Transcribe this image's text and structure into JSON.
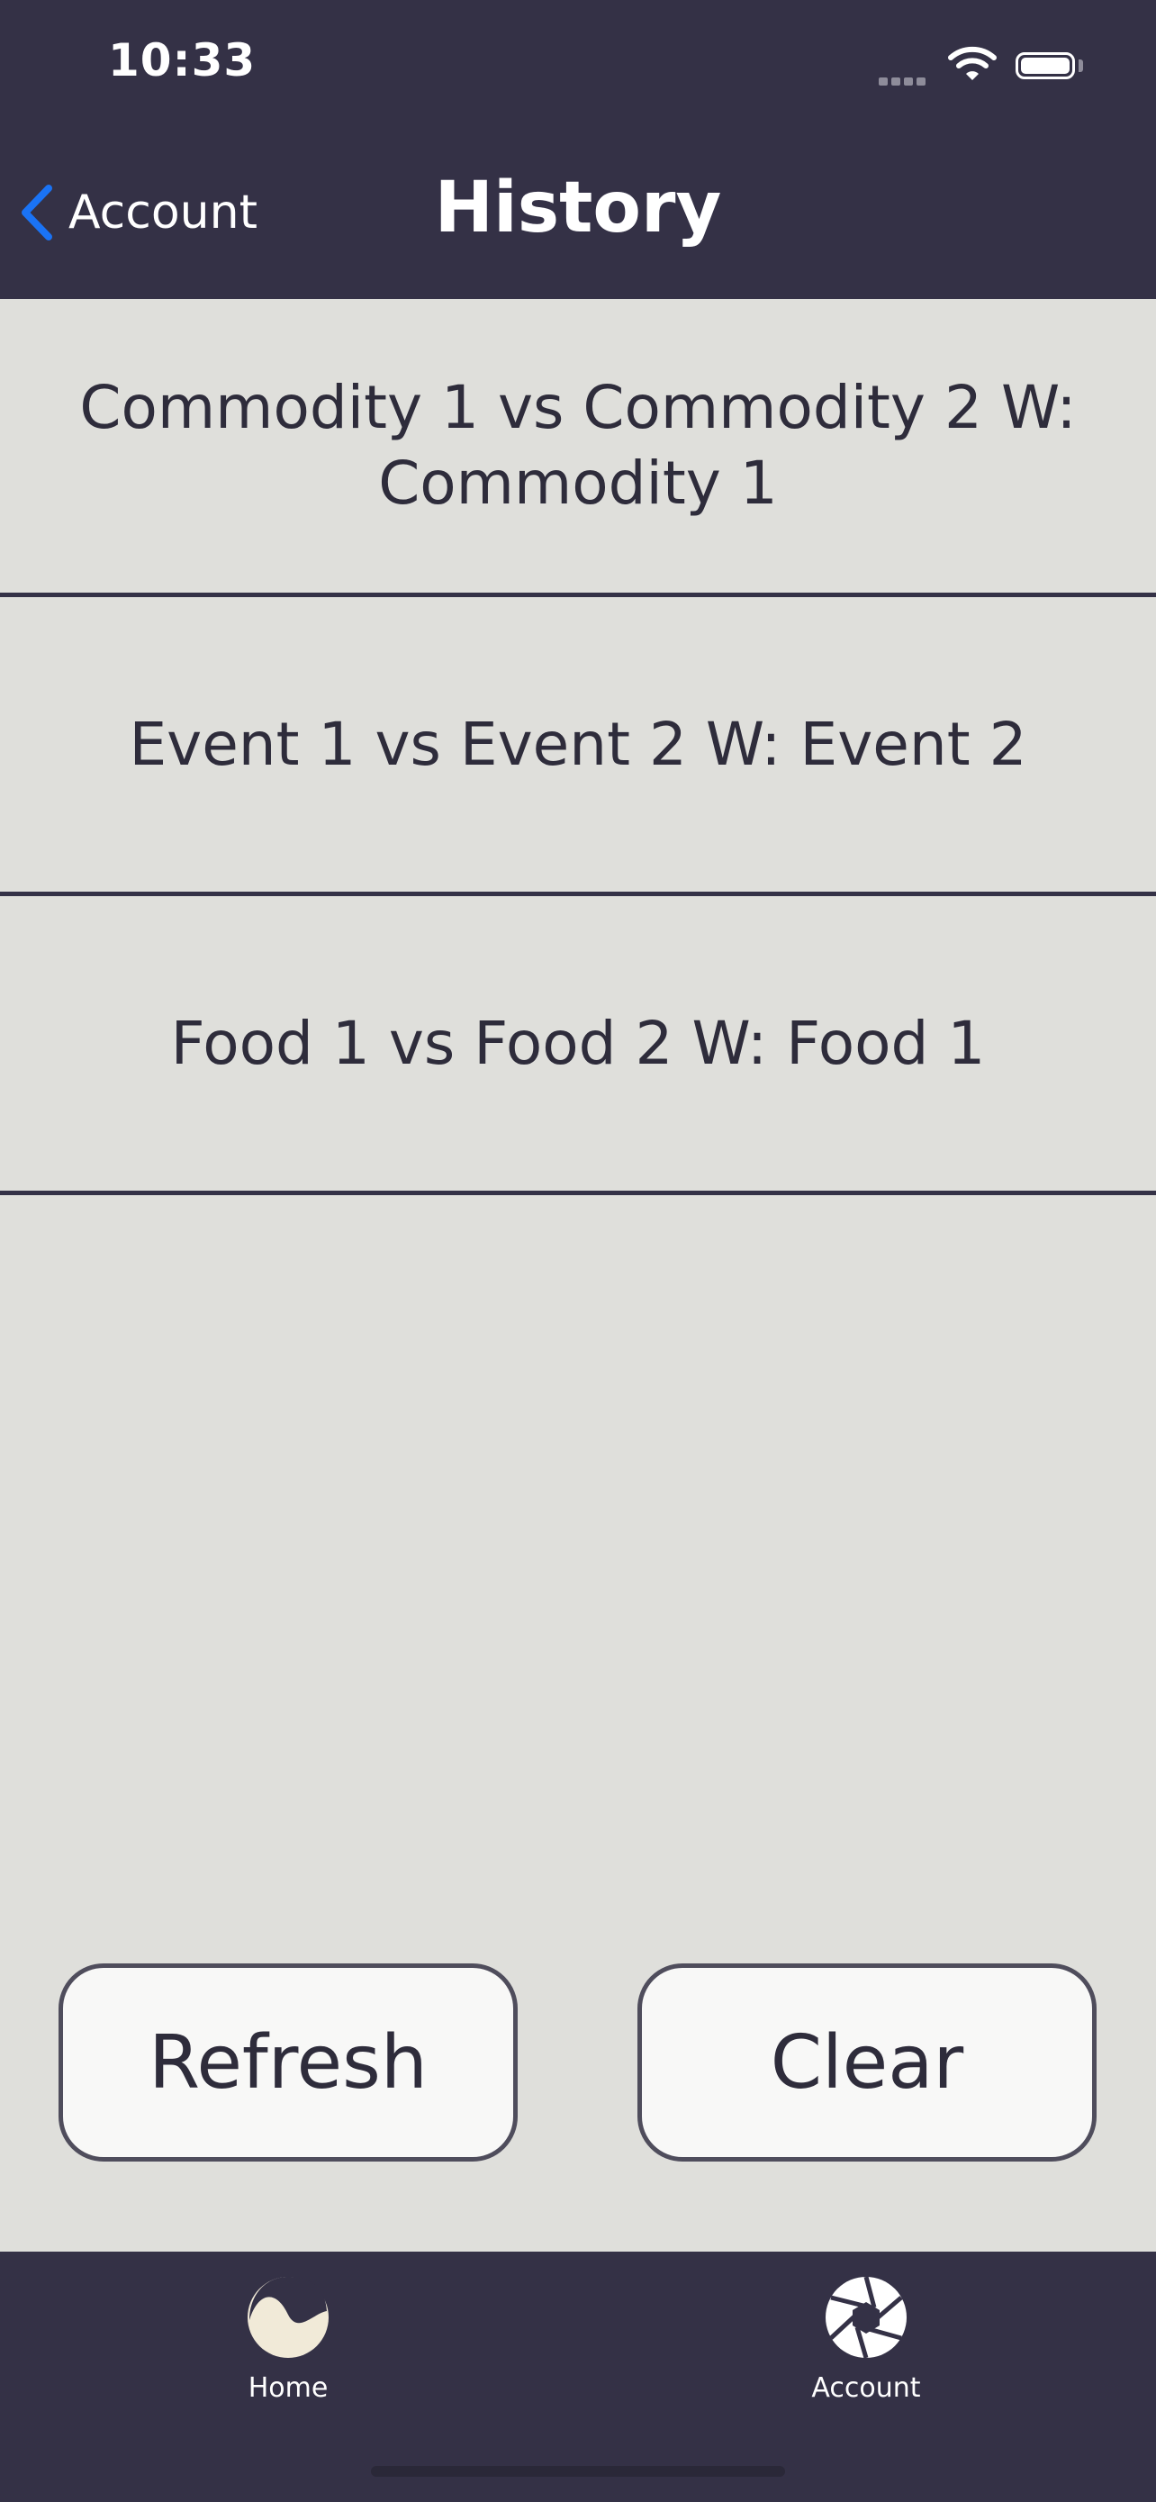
{
  "status_bar": {
    "time": "10:33"
  },
  "nav": {
    "back_label": "Account",
    "title": "History"
  },
  "history": [
    "Commodity 1 vs Commodity 2 W: Commodity 1",
    "Event 1 vs Event 2 W: Event 2",
    "Food 1 vs Food 2 W: Food 1"
  ],
  "actions": {
    "refresh_label": "Refresh",
    "clear_label": "Clear"
  },
  "tabs": [
    {
      "label": "Home",
      "icon": "home-wave-icon"
    },
    {
      "label": "Account",
      "icon": "aperture-icon"
    }
  ],
  "colors": {
    "header_bg": "#343146",
    "content_bg": "#dfdfdb",
    "back_chevron": "#1a73f5",
    "home_icon": "#f1ead8"
  }
}
